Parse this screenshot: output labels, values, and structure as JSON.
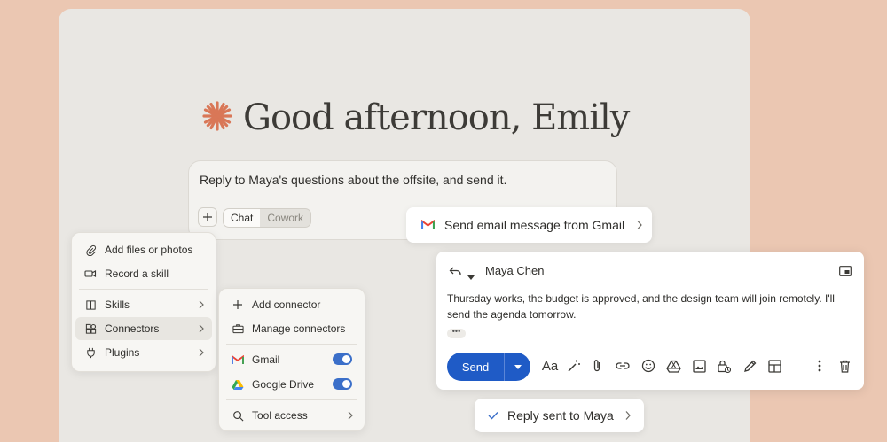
{
  "greeting": {
    "text": "Good afternoon, Emily"
  },
  "prompt": {
    "text": "Reply to Maya's questions about the offsite, and send it.",
    "modes": [
      "Chat",
      "Cowork"
    ]
  },
  "attach_menu": {
    "items": [
      {
        "label": "Add files or photos",
        "icon": "paperclip-icon"
      },
      {
        "label": "Record a skill",
        "icon": "video-camera-icon"
      },
      {
        "label": "Skills",
        "icon": "book-icon"
      },
      {
        "label": "Connectors",
        "icon": "connectors-icon"
      },
      {
        "label": "Plugins",
        "icon": "plug-icon"
      }
    ]
  },
  "connectors_menu": {
    "items": [
      {
        "label": "Add connector",
        "icon": "plus-icon"
      },
      {
        "label": "Manage connectors",
        "icon": "briefcase-icon"
      },
      {
        "label": "Gmail",
        "icon": "gmail-icon",
        "enabled": true
      },
      {
        "label": "Google Drive",
        "icon": "google-drive-icon",
        "enabled": true
      },
      {
        "label": "Tool access",
        "icon": "search-icon"
      }
    ]
  },
  "tool_call": {
    "label": "Send email message from Gmail"
  },
  "email": {
    "recipient": "Maya Chen",
    "body": "Thursday works, the budget is approved, and the design team will join remotely. I'll send the agenda tomorrow.",
    "more": "•••",
    "send_label": "Send",
    "format_label": "Aa"
  },
  "status": {
    "label": "Reply sent to Maya"
  },
  "colors": {
    "background": "#EBC7B2",
    "accent": "#D97757",
    "primary": "#1F5BC6",
    "toggle_on": "#3B6FC9"
  }
}
